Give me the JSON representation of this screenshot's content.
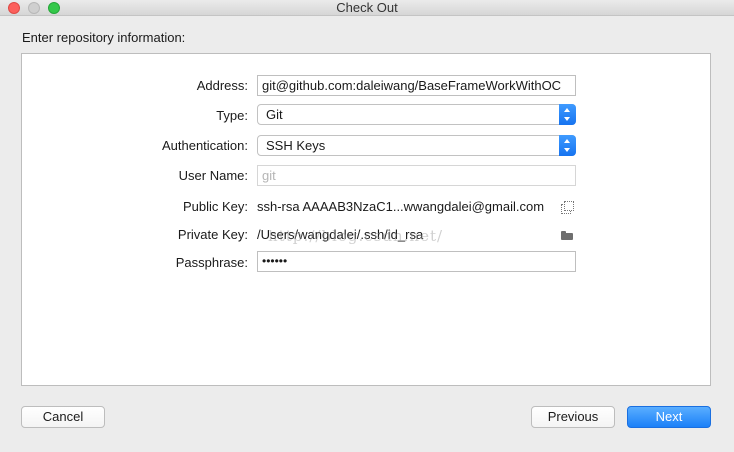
{
  "window": {
    "title": "Check Out"
  },
  "instruction": "Enter repository information:",
  "form": {
    "address": {
      "label": "Address:",
      "value": "git@github.com:daleiwang/BaseFrameWorkWithOC"
    },
    "type": {
      "label": "Type:",
      "value": "Git"
    },
    "authentication": {
      "label": "Authentication:",
      "value": "SSH Keys"
    },
    "username": {
      "label": "User Name:",
      "placeholder": "git"
    },
    "public_key": {
      "label": "Public Key:",
      "value": "ssh-rsa AAAAB3NzaC1...wwangdalei@gmail.com"
    },
    "private_key": {
      "label": "Private Key:",
      "value": "/Users/wangdalei/.ssh/id_rsa"
    },
    "passphrase": {
      "label": "Passphrase:",
      "value": "••••••"
    }
  },
  "watermark": "http://blog.csdn.net/",
  "buttons": {
    "cancel": "Cancel",
    "previous": "Previous",
    "next": "Next"
  },
  "colors": {
    "accent": "#1b80f8",
    "close": "#fc605c",
    "maximize": "#34c84a"
  }
}
